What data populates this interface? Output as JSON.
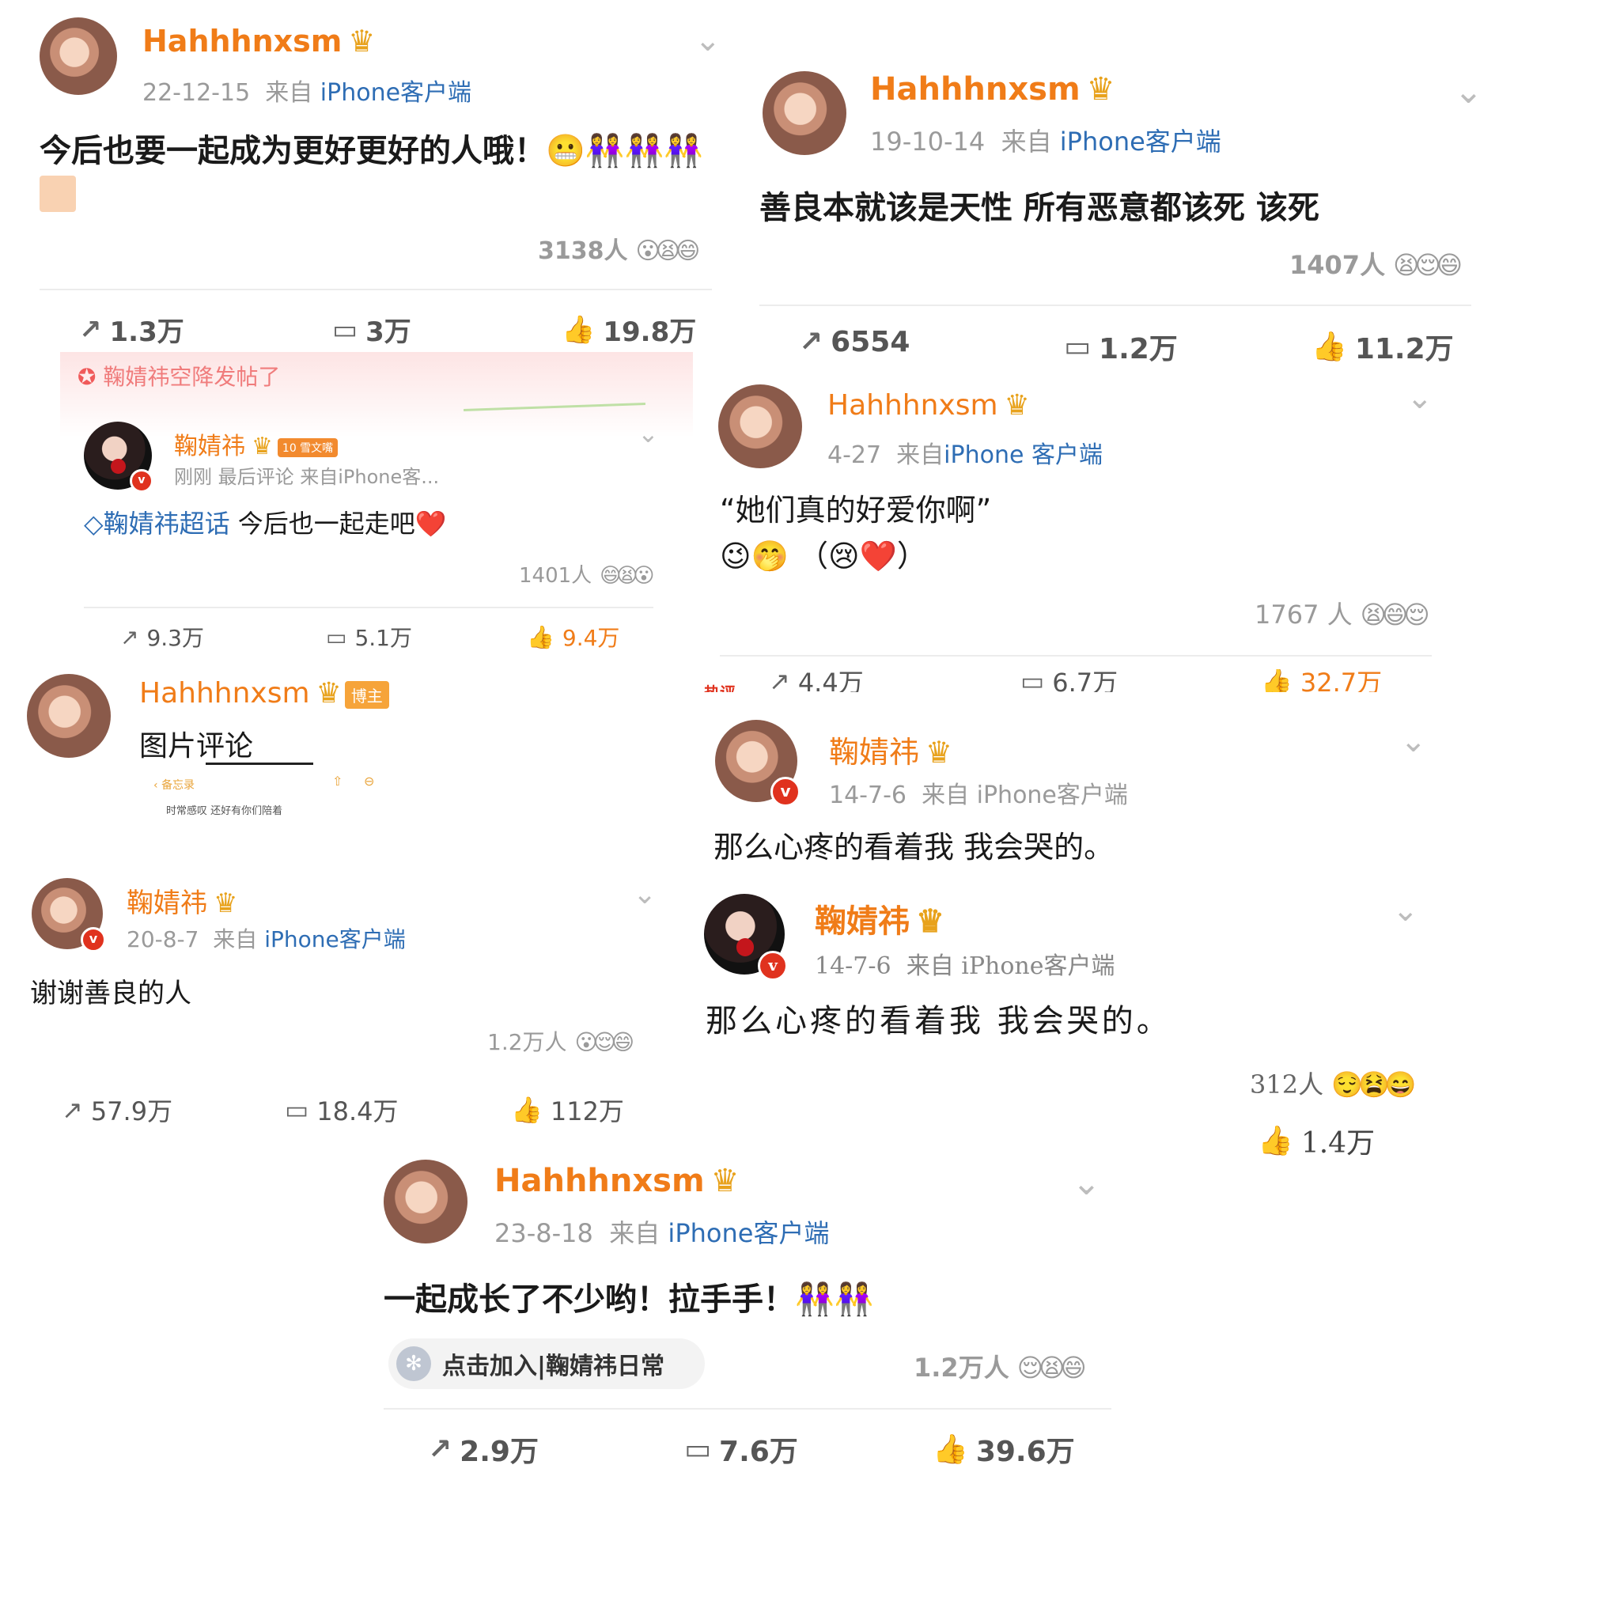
{
  "posts": [
    {
      "name": "Hahhhnxsm",
      "date": "22-12-15",
      "from_prefix": "来自",
      "source": "iPhone客户端",
      "text": "今后也要一起成为更好更好的人哦！",
      "text_emoji": "😬👭👭👭",
      "reactions": "3138人",
      "reaction_faces": "😮😫😄",
      "reposts": "1.3万",
      "comments": "3万",
      "likes": "19.8万"
    },
    {
      "name": "Hahhhnxsm",
      "date": "19-10-14",
      "from_prefix": "来自",
      "source": "iPhone客户端",
      "text": "善良本就该是天性  所有恶意都该死 该死",
      "reactions": "1407人",
      "reaction_faces": "😫😌😄",
      "reposts": "6554",
      "comments": "1.2万",
      "likes": "11.2万"
    },
    {
      "banner": "鞠婧祎空降发帖了",
      "name": "鞠婧祎",
      "tag": "10 雪文嘴",
      "meta": "刚刚 最后评论  来自iPhone客...",
      "topic": "鞠婧祎超话",
      "text": "今后也一起走吧",
      "text_emoji": "❤️",
      "reactions": "1401人",
      "reaction_faces": "😄😫😮",
      "reposts": "9.3万",
      "comments": "5.1万",
      "likes": "9.4万"
    },
    {
      "name": "Hahhhnxsm",
      "date": "4-27",
      "from_prefix": "来自",
      "source": "iPhone 客户端",
      "text_line1": "“她们真的好爱你啊”",
      "text_line2": "😉🤭 （😢❤️）",
      "reactions": "1767 人",
      "reaction_faces": "😫😄😌",
      "partial_label": "热评",
      "reposts": "4.4万",
      "comments": "6.7万",
      "likes": "32.7万"
    },
    {
      "name": "Hahhhnxsm",
      "badge": "博主",
      "text": "图片评论",
      "screenshot_caption": "时常感叹 还好有你们陪着",
      "screenshot_back": "备忘录"
    },
    {
      "name": "鞠婧祎",
      "date": "14-7-6",
      "from_prefix": "来自",
      "source": "iPhone客户端",
      "text": "那么心疼的看着我 我会哭的。"
    },
    {
      "name": "鞠婧祎",
      "date": "20-8-7",
      "from_prefix": "来自",
      "source": "iPhone客户端",
      "text": "谢谢善良的人",
      "reactions": "1.2万人",
      "reaction_faces": "😮😌😄",
      "reposts": "57.9万",
      "comments": "18.4万",
      "likes": "112万"
    },
    {
      "name": "鞠婧祎",
      "date": "14-7-6",
      "from_prefix": "来自",
      "source": "iPhone客户端",
      "text": "那么心疼的看着我 我会哭的。",
      "reactions": "312人",
      "reaction_faces": "😌😫😄",
      "likes": "1.4万"
    },
    {
      "name": "Hahhhnxsm",
      "date": "23-8-18",
      "from_prefix": "来自",
      "source": "iPhone客户端",
      "text": "一起成长了不少哟！拉手手！",
      "text_emoji": "👭👭",
      "join_pill": "点击加入|鞠婧祎日常",
      "reactions": "1.2万人",
      "reaction_faces": "😌😫😄",
      "reposts": "2.9万",
      "comments": "7.6万",
      "likes": "39.6万"
    }
  ],
  "icons": {
    "repost": "repost-icon",
    "comment": "comment-icon",
    "like": "thumbs-up-icon",
    "chevron": "chevron-down-icon",
    "crown": "crown-badge-icon"
  },
  "colors": {
    "username": "#f07c18",
    "source_link": "#2e6db4",
    "meta_gray": "#9a9a9a",
    "verified": "#e0321e"
  }
}
